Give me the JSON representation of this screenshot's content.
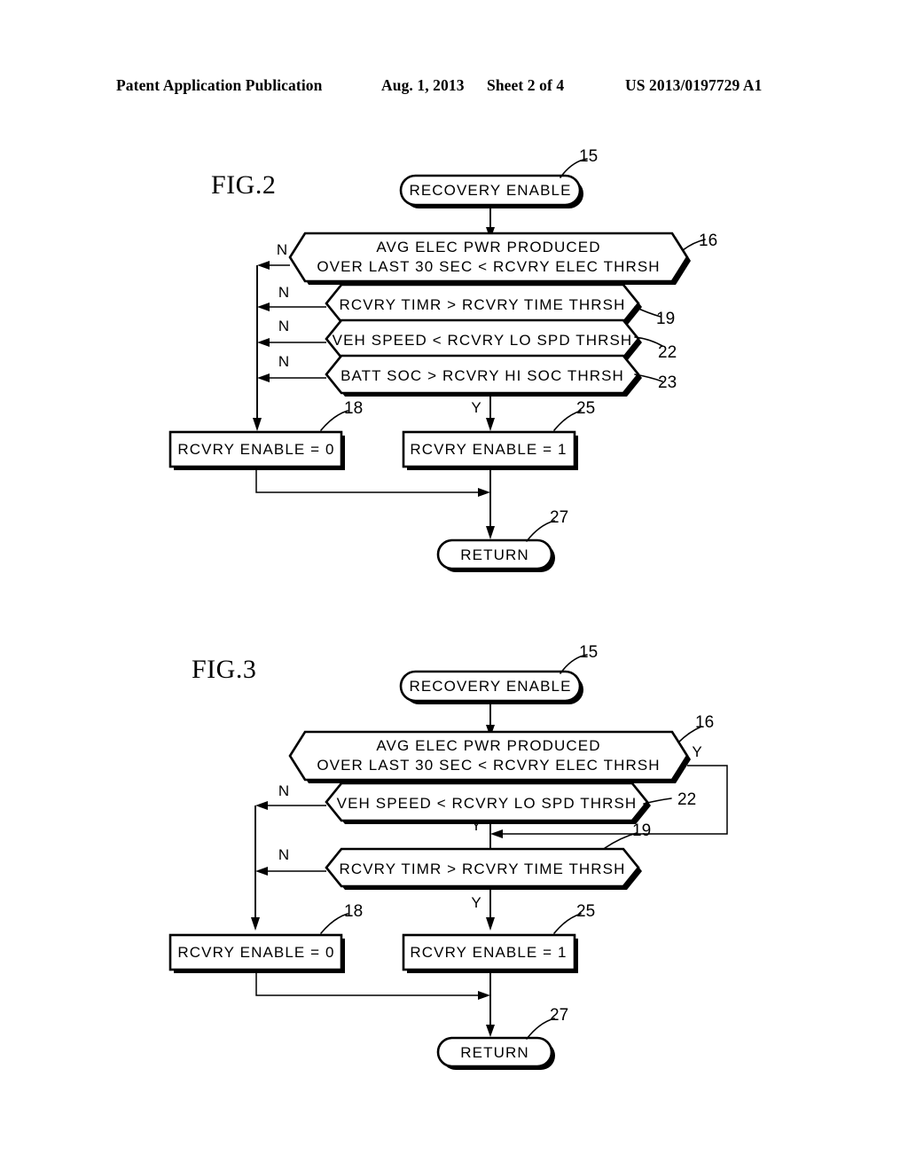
{
  "header": {
    "publication": "Patent Application Publication",
    "date": "Aug. 1, 2013",
    "sheet": "Sheet 2 of 4",
    "patent_number": "US 2013/0197729 A1"
  },
  "figures": [
    {
      "title": "FIG.2",
      "nodes": {
        "start": {
          "label": "RECOVERY  ENABLE",
          "ref": "15"
        },
        "decision1_line1": "AVG  ELEC  PWR  PRODUCED",
        "decision1_line2": "OVER LAST 30 SEC  <  RCVRY ELEC THRSH",
        "decision1_ref": "16",
        "decision2": {
          "label": "RCVRY  TIMR  >  RCVRY  TIME  THRSH",
          "ref": "19"
        },
        "decision3": {
          "label": "VEH  SPEED  <  RCVRY  LO  SPD  THRSH",
          "ref": "22"
        },
        "decision4": {
          "label": "BATT  SOC  >  RCVRY  HI  SOC  THRSH",
          "ref": "23"
        },
        "process_off": {
          "label": "RCVRY  ENABLE  =  0",
          "ref": "18"
        },
        "process_on": {
          "label": "RCVRY  ENABLE  =  1",
          "ref": "25"
        },
        "end": {
          "label": "RETURN",
          "ref": "27"
        }
      },
      "branches": {
        "n1": "N",
        "n2": "N",
        "n3": "N",
        "n4": "N",
        "y_main": "Y"
      }
    },
    {
      "title": "FIG.3",
      "nodes": {
        "start": {
          "label": "RECOVERY  ENABLE",
          "ref": "15"
        },
        "decision1_line1": "AVG  ELEC  PWR  PRODUCED",
        "decision1_line2": "OVER LAST 30 SEC  <  RCVRY ELEC THRSH",
        "decision1_ref": "16",
        "decision2": {
          "label": "VEH  SPEED  <  RCVRY  LO  SPD  THRSH",
          "ref": "22"
        },
        "decision3": {
          "label": "RCVRY  TIMR  >  RCVRY  TIME  THRSH",
          "ref": "19"
        },
        "process_off": {
          "label": "RCVRY  ENABLE  =  0",
          "ref": "18"
        },
        "process_on": {
          "label": "RCVRY  ENABLE  =  1",
          "ref": "25"
        },
        "end": {
          "label": "RETURN",
          "ref": "27"
        }
      },
      "branches": {
        "y_bypass": "Y",
        "n1": "N",
        "y_mid": "Y",
        "n2": "N",
        "y_main": "Y"
      }
    }
  ]
}
